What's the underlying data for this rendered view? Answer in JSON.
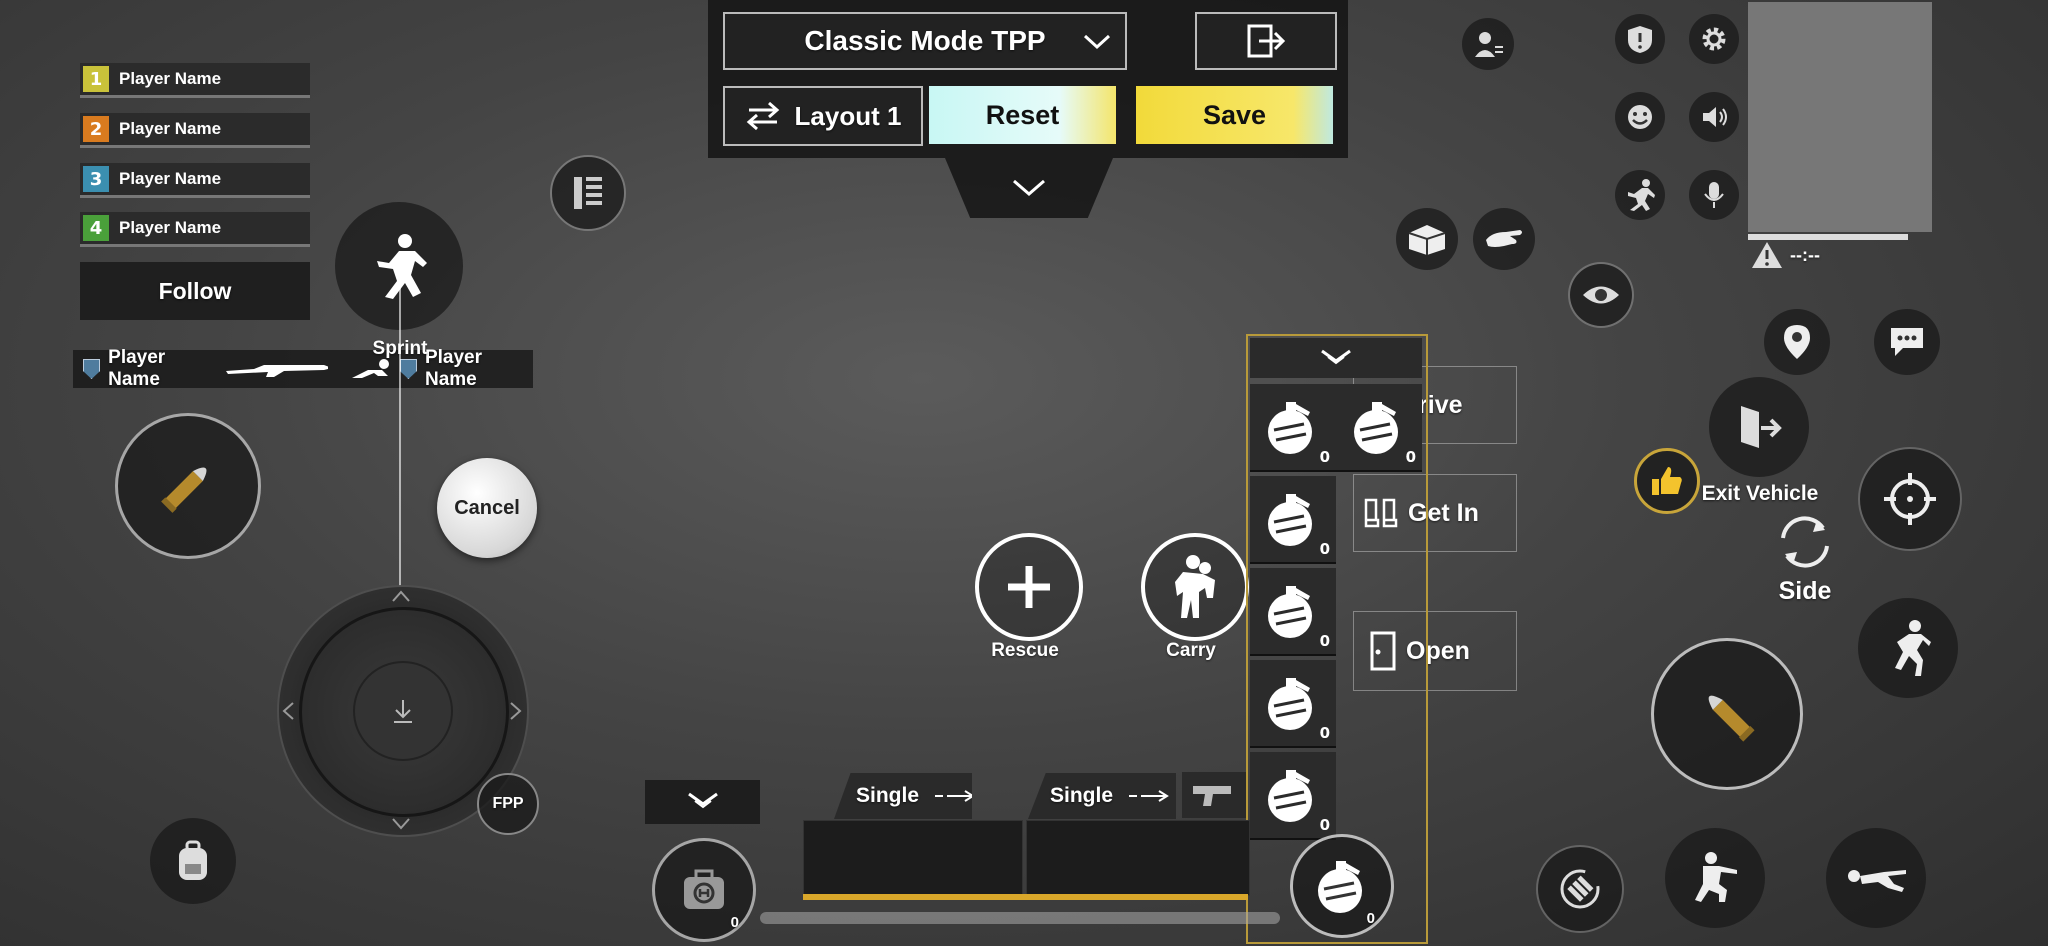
{
  "top_bar": {
    "mode_label": "Classic Mode TPP",
    "layout_label": "Layout 1",
    "reset_label": "Reset",
    "save_label": "Save"
  },
  "team": {
    "members": [
      {
        "num": "1",
        "name": "Player Name",
        "color": "#c9c23a"
      },
      {
        "num": "2",
        "name": "Player Name",
        "color": "#d97b1f"
      },
      {
        "num": "3",
        "name": "Player Name",
        "color": "#3b8fb0"
      },
      {
        "num": "4",
        "name": "Player Name",
        "color": "#4aa03a"
      }
    ],
    "follow_label": "Follow"
  },
  "killfeed": {
    "killer": "Player Name",
    "victim": "Player Name"
  },
  "left_controls": {
    "sprint_label": "Sprint",
    "cancel_label": "Cancel",
    "fpp_label": "FPP"
  },
  "center_actions": {
    "rescue_label": "Rescue",
    "carry_label": "Carry"
  },
  "vehicle_actions": {
    "drive_label": "Drive",
    "get_in_label": "Get In",
    "open_label": "Open"
  },
  "throwables": {
    "counts": [
      "0",
      "0",
      "0",
      "0",
      "0",
      "0"
    ],
    "active_count": "0"
  },
  "weapons": {
    "slot1_mode": "Single",
    "slot2_mode": "Single"
  },
  "heal": {
    "count": "0"
  },
  "right_controls": {
    "exit_vehicle_label": "Exit Vehicle",
    "side_label": "Side",
    "minimap_status": "--:--"
  },
  "colors": {
    "save_yellow": "#f5e14a",
    "reset_cyan": "#c8f7f4",
    "accent_gold": "#c8a53a"
  }
}
